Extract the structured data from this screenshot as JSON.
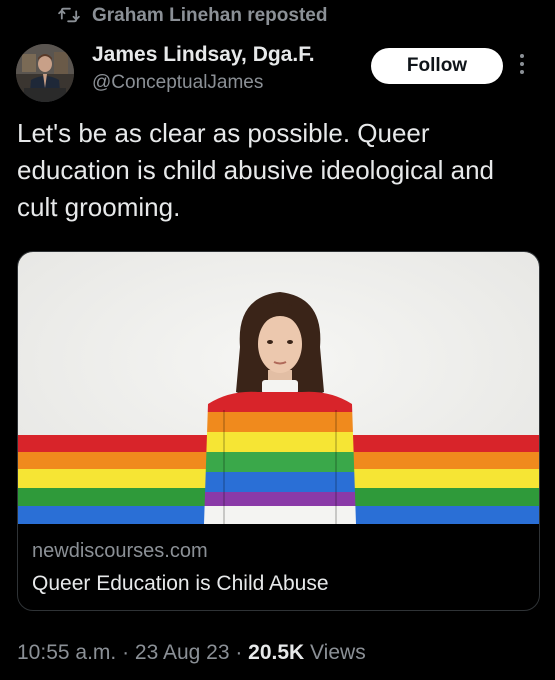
{
  "repost": {
    "text": "Graham Linehan reposted",
    "icon": "repost-icon"
  },
  "author": {
    "name": "James Lindsay, Dga.F.",
    "handle": "@ConceptualJames",
    "avatar_icon": "avatar"
  },
  "actions": {
    "follow_label": "Follow",
    "more_icon": "more-icon"
  },
  "tweet": {
    "text": "Let's be as clear as possible. Queer education is child abusive ideological and cult grooming."
  },
  "link_card": {
    "domain": "newdiscourses.com",
    "title": "Queer Education is Child Abuse"
  },
  "meta": {
    "time": "10:55 a.m.",
    "sep1": " · ",
    "date": "23 Aug 23",
    "sep2": " · ",
    "views_count": "20.5K",
    "views_label": " Views"
  },
  "colors": {
    "background": "#000000",
    "text_primary": "#e7e9ea",
    "text_secondary": "#8b9096",
    "follow_bg": "#ffffff",
    "card_border": "#2f3336",
    "rainbow": [
      "#d8242a",
      "#f08a1d",
      "#f6e534",
      "#2f9a3a",
      "#2a6fd6",
      "#7b3aa8"
    ]
  }
}
